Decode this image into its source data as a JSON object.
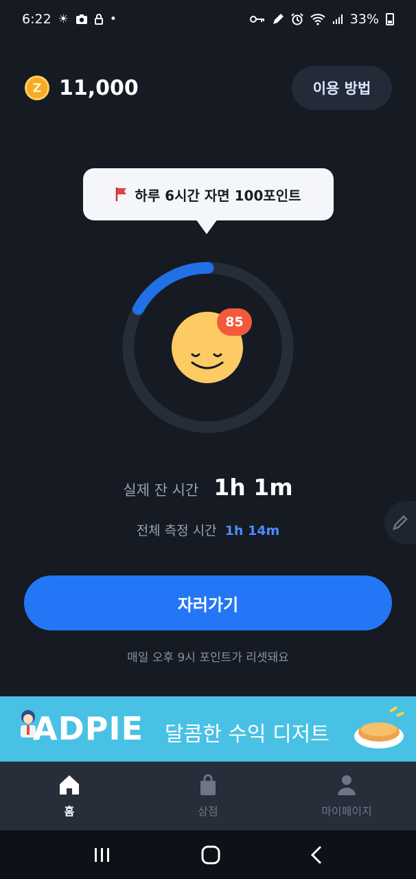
{
  "status_bar": {
    "time": "6:22",
    "battery": "33%",
    "left_icons": [
      "brightness-icon",
      "camera-icon",
      "lock-icon",
      "dot-icon"
    ],
    "right_icons": [
      "key-icon",
      "edit-icon",
      "alarm-icon",
      "wifi-icon",
      "signal-icon",
      "battery-icon"
    ]
  },
  "header": {
    "points": "11,000",
    "coin_letter": "Z",
    "howto_label": "이용 방법"
  },
  "tooltip": {
    "text": "하루 6시간 자면 100포인트"
  },
  "progress": {
    "fraction": 0.17,
    "badge": "85",
    "track_color": "#262c38",
    "arc_color": "#2270e6",
    "face_color": "#fdcb63"
  },
  "stats": {
    "actual_label": "실제 잔 시간",
    "actual_value": "1h 1m",
    "total_label": "전체 측정 시간",
    "total_value": "1h 14m"
  },
  "action": {
    "sleep_label": "자러가기",
    "reset_note": "매일 오후 9시 포인트가 리셋돼요"
  },
  "ad": {
    "logo": "ADPIE",
    "text": "달콤한 수익 디저트"
  },
  "bottom_nav": {
    "items": [
      {
        "label": "홈",
        "icon": "home-icon",
        "active": true
      },
      {
        "label": "상점",
        "icon": "shopping-bag-icon",
        "active": false
      },
      {
        "label": "마이페이지",
        "icon": "person-icon",
        "active": false
      }
    ]
  },
  "colors": {
    "background": "#151a23",
    "primary": "#2377f6",
    "accent_blue_text": "#4d8cff",
    "badge": "#f25a3b",
    "ad_background": "#49c1e4"
  }
}
